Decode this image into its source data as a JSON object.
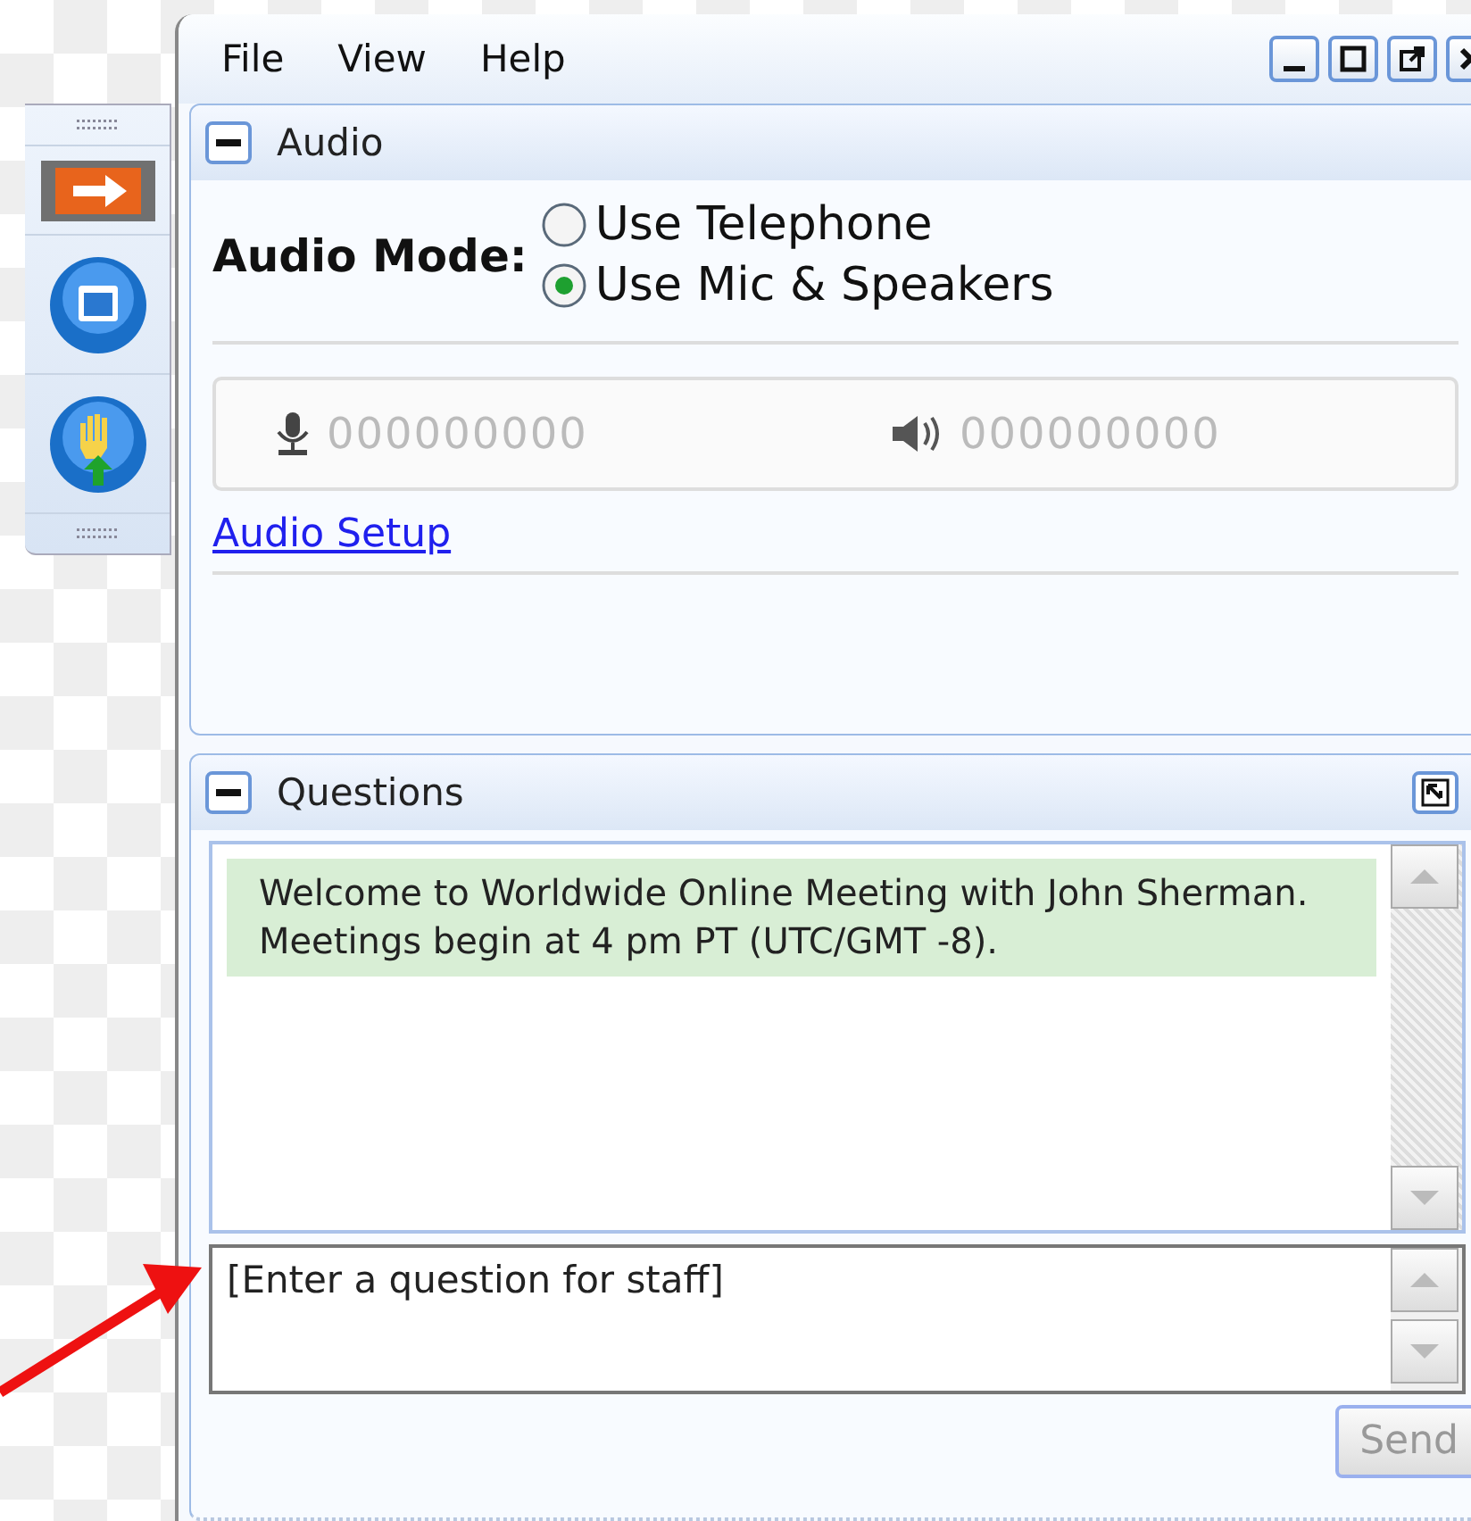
{
  "toolbar": {
    "items": [
      {
        "kind": "arrow",
        "selected": true
      },
      {
        "kind": "screen",
        "selected": false
      },
      {
        "kind": "hand",
        "selected": false
      }
    ]
  },
  "menu": [
    "File",
    "View",
    "Help"
  ],
  "audio": {
    "title": "Audio",
    "mode_label": "Audio Mode:",
    "options": [
      {
        "label": "Use Telephone",
        "selected": false
      },
      {
        "label": "Use Mic & Speakers",
        "selected": true
      }
    ],
    "mic_reading": "000000000",
    "speaker_reading": "000000000",
    "setup_link": "Audio Setup"
  },
  "questions": {
    "title": "Questions",
    "messages": [
      "Welcome to Worldwide Online Meeting with John Sherman.  Meetings begin at 4 pm PT (UTC/GMT -8)."
    ],
    "input": {
      "placeholder": "[Enter a question for staff]"
    },
    "send": {
      "label": "Send",
      "disabled": true
    }
  }
}
